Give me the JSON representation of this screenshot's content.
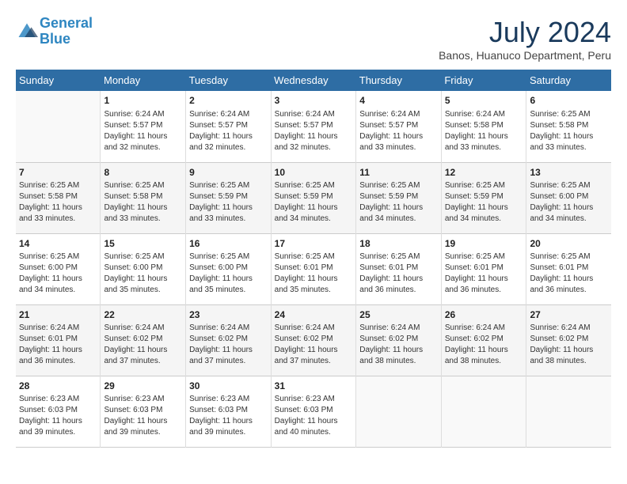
{
  "logo": {
    "line1": "General",
    "line2": "Blue"
  },
  "title": "July 2024",
  "location": "Banos, Huanuco Department, Peru",
  "weekdays": [
    "Sunday",
    "Monday",
    "Tuesday",
    "Wednesday",
    "Thursday",
    "Friday",
    "Saturday"
  ],
  "weeks": [
    [
      {
        "day": "",
        "info": ""
      },
      {
        "day": "1",
        "info": "Sunrise: 6:24 AM\nSunset: 5:57 PM\nDaylight: 11 hours\nand 32 minutes."
      },
      {
        "day": "2",
        "info": "Sunrise: 6:24 AM\nSunset: 5:57 PM\nDaylight: 11 hours\nand 32 minutes."
      },
      {
        "day": "3",
        "info": "Sunrise: 6:24 AM\nSunset: 5:57 PM\nDaylight: 11 hours\nand 32 minutes."
      },
      {
        "day": "4",
        "info": "Sunrise: 6:24 AM\nSunset: 5:57 PM\nDaylight: 11 hours\nand 33 minutes."
      },
      {
        "day": "5",
        "info": "Sunrise: 6:24 AM\nSunset: 5:58 PM\nDaylight: 11 hours\nand 33 minutes."
      },
      {
        "day": "6",
        "info": "Sunrise: 6:25 AM\nSunset: 5:58 PM\nDaylight: 11 hours\nand 33 minutes."
      }
    ],
    [
      {
        "day": "7",
        "info": "Sunrise: 6:25 AM\nSunset: 5:58 PM\nDaylight: 11 hours\nand 33 minutes."
      },
      {
        "day": "8",
        "info": "Sunrise: 6:25 AM\nSunset: 5:58 PM\nDaylight: 11 hours\nand 33 minutes."
      },
      {
        "day": "9",
        "info": "Sunrise: 6:25 AM\nSunset: 5:59 PM\nDaylight: 11 hours\nand 33 minutes."
      },
      {
        "day": "10",
        "info": "Sunrise: 6:25 AM\nSunset: 5:59 PM\nDaylight: 11 hours\nand 34 minutes."
      },
      {
        "day": "11",
        "info": "Sunrise: 6:25 AM\nSunset: 5:59 PM\nDaylight: 11 hours\nand 34 minutes."
      },
      {
        "day": "12",
        "info": "Sunrise: 6:25 AM\nSunset: 5:59 PM\nDaylight: 11 hours\nand 34 minutes."
      },
      {
        "day": "13",
        "info": "Sunrise: 6:25 AM\nSunset: 6:00 PM\nDaylight: 11 hours\nand 34 minutes."
      }
    ],
    [
      {
        "day": "14",
        "info": "Sunrise: 6:25 AM\nSunset: 6:00 PM\nDaylight: 11 hours\nand 34 minutes."
      },
      {
        "day": "15",
        "info": "Sunrise: 6:25 AM\nSunset: 6:00 PM\nDaylight: 11 hours\nand 35 minutes."
      },
      {
        "day": "16",
        "info": "Sunrise: 6:25 AM\nSunset: 6:00 PM\nDaylight: 11 hours\nand 35 minutes."
      },
      {
        "day": "17",
        "info": "Sunrise: 6:25 AM\nSunset: 6:01 PM\nDaylight: 11 hours\nand 35 minutes."
      },
      {
        "day": "18",
        "info": "Sunrise: 6:25 AM\nSunset: 6:01 PM\nDaylight: 11 hours\nand 36 minutes."
      },
      {
        "day": "19",
        "info": "Sunrise: 6:25 AM\nSunset: 6:01 PM\nDaylight: 11 hours\nand 36 minutes."
      },
      {
        "day": "20",
        "info": "Sunrise: 6:25 AM\nSunset: 6:01 PM\nDaylight: 11 hours\nand 36 minutes."
      }
    ],
    [
      {
        "day": "21",
        "info": "Sunrise: 6:24 AM\nSunset: 6:01 PM\nDaylight: 11 hours\nand 36 minutes."
      },
      {
        "day": "22",
        "info": "Sunrise: 6:24 AM\nSunset: 6:02 PM\nDaylight: 11 hours\nand 37 minutes."
      },
      {
        "day": "23",
        "info": "Sunrise: 6:24 AM\nSunset: 6:02 PM\nDaylight: 11 hours\nand 37 minutes."
      },
      {
        "day": "24",
        "info": "Sunrise: 6:24 AM\nSunset: 6:02 PM\nDaylight: 11 hours\nand 37 minutes."
      },
      {
        "day": "25",
        "info": "Sunrise: 6:24 AM\nSunset: 6:02 PM\nDaylight: 11 hours\nand 38 minutes."
      },
      {
        "day": "26",
        "info": "Sunrise: 6:24 AM\nSunset: 6:02 PM\nDaylight: 11 hours\nand 38 minutes."
      },
      {
        "day": "27",
        "info": "Sunrise: 6:24 AM\nSunset: 6:02 PM\nDaylight: 11 hours\nand 38 minutes."
      }
    ],
    [
      {
        "day": "28",
        "info": "Sunrise: 6:23 AM\nSunset: 6:03 PM\nDaylight: 11 hours\nand 39 minutes."
      },
      {
        "day": "29",
        "info": "Sunrise: 6:23 AM\nSunset: 6:03 PM\nDaylight: 11 hours\nand 39 minutes."
      },
      {
        "day": "30",
        "info": "Sunrise: 6:23 AM\nSunset: 6:03 PM\nDaylight: 11 hours\nand 39 minutes."
      },
      {
        "day": "31",
        "info": "Sunrise: 6:23 AM\nSunset: 6:03 PM\nDaylight: 11 hours\nand 40 minutes."
      },
      {
        "day": "",
        "info": ""
      },
      {
        "day": "",
        "info": ""
      },
      {
        "day": "",
        "info": ""
      }
    ]
  ]
}
